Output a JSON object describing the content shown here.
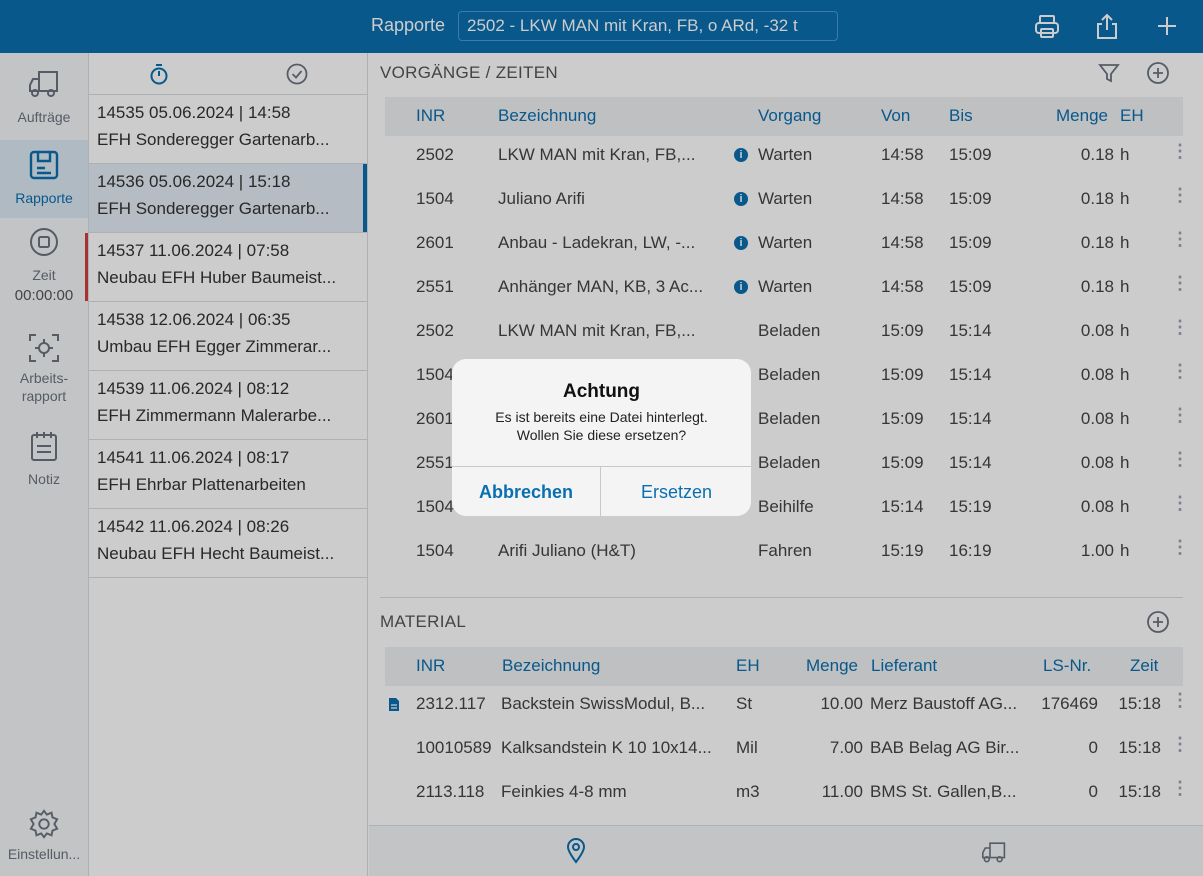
{
  "header": {
    "title": "Rapporte",
    "selector_value": "2502 - LKW MAN mit Kran, FB, o ARd, -32 t",
    "icons": [
      "printer-icon",
      "share-icon",
      "plus-icon"
    ]
  },
  "nav": {
    "items": [
      {
        "label": "Aufträge",
        "icon": "truck-icon"
      },
      {
        "label": "Rapporte",
        "icon": "report-icon"
      },
      {
        "label": "Zeit",
        "icon": "stop-icon"
      },
      {
        "label": "Arbeits-rapport",
        "icon": "scan-icon"
      },
      {
        "label": "Notiz",
        "icon": "notepad-icon"
      }
    ],
    "timer": "00:00:00",
    "settings_label": "Einstellun..."
  },
  "reports": [
    {
      "line1": "14535  05.06.2024 | 14:58",
      "line2": "EFH Sonderegger Gartenarb..."
    },
    {
      "line1": "14536  05.06.2024 | 15:18",
      "line2": "EFH Sonderegger Gartenarb..."
    },
    {
      "line1": "14537  11.06.2024 | 07:58",
      "line2": "Neubau EFH Huber Baumeist..."
    },
    {
      "line1": "14538  12.06.2024 | 06:35",
      "line2": "Umbau EFH Egger Zimmerar..."
    },
    {
      "line1": "14539  11.06.2024 | 08:12",
      "line2": "EFH Zimmermann Malerarbe..."
    },
    {
      "line1": "14541  11.06.2024 | 08:17",
      "line2": "EFH Ehrbar Plattenarbeiten"
    },
    {
      "line1": "14542  11.06.2024 | 08:26",
      "line2": "Neubau EFH Hecht Baumeist..."
    }
  ],
  "vorgaenge": {
    "title": "VORGÄNGE / ZEITEN",
    "headers": {
      "inr": "INR",
      "bez": "Bezeichnung",
      "vorgang": "Vorgang",
      "von": "Von",
      "bis": "Bis",
      "menge": "Menge",
      "eh": "EH"
    },
    "rows": [
      {
        "inr": "2502",
        "bez": "LKW MAN mit Kran, FB,...",
        "vorgang": "Warten",
        "von": "14:58",
        "bis": "15:09",
        "menge": "0.18",
        "eh": "h"
      },
      {
        "inr": "1504",
        "bez": "Juliano Arifi",
        "vorgang": "Warten",
        "von": "14:58",
        "bis": "15:09",
        "menge": "0.18",
        "eh": "h"
      },
      {
        "inr": "2601",
        "bez": "Anbau - Ladekran, LW, -...",
        "vorgang": "Warten",
        "von": "14:58",
        "bis": "15:09",
        "menge": "0.18",
        "eh": "h"
      },
      {
        "inr": "2551",
        "bez": "Anhänger MAN, KB, 3 Ac...",
        "vorgang": "Warten",
        "von": "14:58",
        "bis": "15:09",
        "menge": "0.18",
        "eh": "h"
      },
      {
        "inr": "2502",
        "bez": "LKW MAN mit Kran, FB,...",
        "vorgang": "Beladen",
        "von": "15:09",
        "bis": "15:14",
        "menge": "0.08",
        "eh": "h"
      },
      {
        "inr": "1504",
        "bez": "",
        "vorgang": "Beladen",
        "von": "15:09",
        "bis": "15:14",
        "menge": "0.08",
        "eh": "h"
      },
      {
        "inr": "2601",
        "bez": "",
        "vorgang": "Beladen",
        "von": "15:09",
        "bis": "15:14",
        "menge": "0.08",
        "eh": "h"
      },
      {
        "inr": "2551",
        "bez": "",
        "vorgang": "Beladen",
        "von": "15:09",
        "bis": "15:14",
        "menge": "0.08",
        "eh": "h"
      },
      {
        "inr": "1504",
        "bez": "",
        "vorgang": "Beihilfe",
        "von": "15:14",
        "bis": "15:19",
        "menge": "0.08",
        "eh": "h"
      },
      {
        "inr": "1504",
        "bez": "Arifi Juliano (H&T)",
        "vorgang": "Fahren",
        "von": "15:19",
        "bis": "16:19",
        "menge": "1.00",
        "eh": "h"
      }
    ]
  },
  "material": {
    "title": "MATERIAL",
    "headers": {
      "inr": "INR",
      "bez": "Bezeichnung",
      "eh": "EH",
      "menge": "Menge",
      "lieferant": "Lieferant",
      "ls": "LS-Nr.",
      "zeit": "Zeit"
    },
    "rows": [
      {
        "inr": "2312.117",
        "bez": "Backstein SwissModul, B...",
        "eh": "St",
        "menge": "10.00",
        "lieferant": "Merz Baustoff AG...",
        "ls": "176469",
        "zeit": "15:18"
      },
      {
        "inr": "10010589",
        "bez": "Kalksandstein K 10 10x14...",
        "eh": "Mil",
        "menge": "7.00",
        "lieferant": "BAB Belag AG Bir...",
        "ls": "0",
        "zeit": "15:18"
      },
      {
        "inr": "2113.118",
        "bez": "Feinkies 4-8 mm",
        "eh": "m3",
        "menge": "11.00",
        "lieferant": "BMS St. Gallen,B...",
        "ls": "0",
        "zeit": "15:18"
      }
    ]
  },
  "dialog": {
    "title": "Achtung",
    "message_line1": "Es ist bereits eine Datei hinterlegt.",
    "message_line2": "Wollen Sie diese ersetzen?",
    "cancel": "Abbrechen",
    "confirm": "Ersetzen"
  },
  "colors": {
    "accent": "#0a6fb0",
    "flag": "#d23c3c"
  }
}
